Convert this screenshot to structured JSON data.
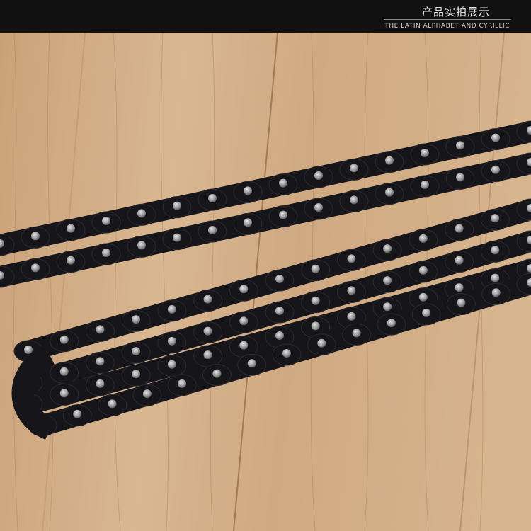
{
  "header": {
    "title": "产品实拍展示",
    "subtitle": "THE LATIN ALPHABET AND CYRILLIC"
  },
  "photo": {
    "subject": "black bicycle chain on wooden surface",
    "colors": {
      "wood_light": "#d9b892",
      "wood_mid": "#c69c70",
      "wood_dark": "#8f6540",
      "chain_plate": "#16161a",
      "pin": "#a9a9a9",
      "roller": "#b9a583"
    }
  }
}
